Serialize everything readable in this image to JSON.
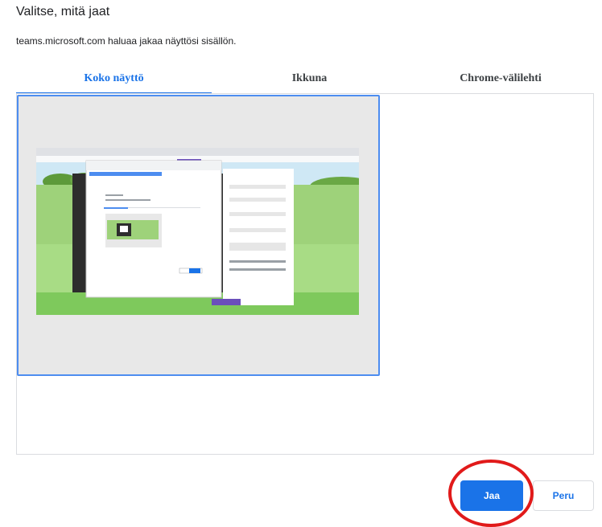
{
  "dialog": {
    "title": "Valitse, mitä jaat",
    "subtitle": "teams.microsoft.com haluaa jakaa näyttösi sisällön."
  },
  "tabs": [
    {
      "label": "Koko näyttö",
      "active": true
    },
    {
      "label": "Ikkuna",
      "active": false
    },
    {
      "label": "Chrome-välilehti",
      "active": false
    }
  ],
  "buttons": {
    "share_label": "Jaa",
    "cancel_label": "Peru"
  },
  "colors": {
    "accent": "#1a73e8",
    "highlight_ring": "#e11a1a",
    "selection_border": "#4d8df0"
  },
  "icons": {
    "preview": "screen-thumbnail"
  }
}
